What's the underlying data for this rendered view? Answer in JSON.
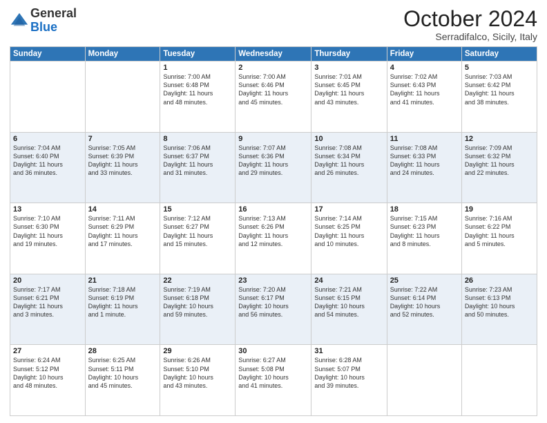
{
  "header": {
    "logo": {
      "line1": "General",
      "line2": "Blue"
    },
    "title": "October 2024",
    "subtitle": "Serradifalco, Sicily, Italy"
  },
  "days_of_week": [
    "Sunday",
    "Monday",
    "Tuesday",
    "Wednesday",
    "Thursday",
    "Friday",
    "Saturday"
  ],
  "weeks": [
    [
      {
        "day": "",
        "info": ""
      },
      {
        "day": "",
        "info": ""
      },
      {
        "day": "1",
        "info": "Sunrise: 7:00 AM\nSunset: 6:48 PM\nDaylight: 11 hours\nand 48 minutes."
      },
      {
        "day": "2",
        "info": "Sunrise: 7:00 AM\nSunset: 6:46 PM\nDaylight: 11 hours\nand 45 minutes."
      },
      {
        "day": "3",
        "info": "Sunrise: 7:01 AM\nSunset: 6:45 PM\nDaylight: 11 hours\nand 43 minutes."
      },
      {
        "day": "4",
        "info": "Sunrise: 7:02 AM\nSunset: 6:43 PM\nDaylight: 11 hours\nand 41 minutes."
      },
      {
        "day": "5",
        "info": "Sunrise: 7:03 AM\nSunset: 6:42 PM\nDaylight: 11 hours\nand 38 minutes."
      }
    ],
    [
      {
        "day": "6",
        "info": "Sunrise: 7:04 AM\nSunset: 6:40 PM\nDaylight: 11 hours\nand 36 minutes."
      },
      {
        "day": "7",
        "info": "Sunrise: 7:05 AM\nSunset: 6:39 PM\nDaylight: 11 hours\nand 33 minutes."
      },
      {
        "day": "8",
        "info": "Sunrise: 7:06 AM\nSunset: 6:37 PM\nDaylight: 11 hours\nand 31 minutes."
      },
      {
        "day": "9",
        "info": "Sunrise: 7:07 AM\nSunset: 6:36 PM\nDaylight: 11 hours\nand 29 minutes."
      },
      {
        "day": "10",
        "info": "Sunrise: 7:08 AM\nSunset: 6:34 PM\nDaylight: 11 hours\nand 26 minutes."
      },
      {
        "day": "11",
        "info": "Sunrise: 7:08 AM\nSunset: 6:33 PM\nDaylight: 11 hours\nand 24 minutes."
      },
      {
        "day": "12",
        "info": "Sunrise: 7:09 AM\nSunset: 6:32 PM\nDaylight: 11 hours\nand 22 minutes."
      }
    ],
    [
      {
        "day": "13",
        "info": "Sunrise: 7:10 AM\nSunset: 6:30 PM\nDaylight: 11 hours\nand 19 minutes."
      },
      {
        "day": "14",
        "info": "Sunrise: 7:11 AM\nSunset: 6:29 PM\nDaylight: 11 hours\nand 17 minutes."
      },
      {
        "day": "15",
        "info": "Sunrise: 7:12 AM\nSunset: 6:27 PM\nDaylight: 11 hours\nand 15 minutes."
      },
      {
        "day": "16",
        "info": "Sunrise: 7:13 AM\nSunset: 6:26 PM\nDaylight: 11 hours\nand 12 minutes."
      },
      {
        "day": "17",
        "info": "Sunrise: 7:14 AM\nSunset: 6:25 PM\nDaylight: 11 hours\nand 10 minutes."
      },
      {
        "day": "18",
        "info": "Sunrise: 7:15 AM\nSunset: 6:23 PM\nDaylight: 11 hours\nand 8 minutes."
      },
      {
        "day": "19",
        "info": "Sunrise: 7:16 AM\nSunset: 6:22 PM\nDaylight: 11 hours\nand 5 minutes."
      }
    ],
    [
      {
        "day": "20",
        "info": "Sunrise: 7:17 AM\nSunset: 6:21 PM\nDaylight: 11 hours\nand 3 minutes."
      },
      {
        "day": "21",
        "info": "Sunrise: 7:18 AM\nSunset: 6:19 PM\nDaylight: 11 hours\nand 1 minute."
      },
      {
        "day": "22",
        "info": "Sunrise: 7:19 AM\nSunset: 6:18 PM\nDaylight: 10 hours\nand 59 minutes."
      },
      {
        "day": "23",
        "info": "Sunrise: 7:20 AM\nSunset: 6:17 PM\nDaylight: 10 hours\nand 56 minutes."
      },
      {
        "day": "24",
        "info": "Sunrise: 7:21 AM\nSunset: 6:15 PM\nDaylight: 10 hours\nand 54 minutes."
      },
      {
        "day": "25",
        "info": "Sunrise: 7:22 AM\nSunset: 6:14 PM\nDaylight: 10 hours\nand 52 minutes."
      },
      {
        "day": "26",
        "info": "Sunrise: 7:23 AM\nSunset: 6:13 PM\nDaylight: 10 hours\nand 50 minutes."
      }
    ],
    [
      {
        "day": "27",
        "info": "Sunrise: 6:24 AM\nSunset: 5:12 PM\nDaylight: 10 hours\nand 48 minutes."
      },
      {
        "day": "28",
        "info": "Sunrise: 6:25 AM\nSunset: 5:11 PM\nDaylight: 10 hours\nand 45 minutes."
      },
      {
        "day": "29",
        "info": "Sunrise: 6:26 AM\nSunset: 5:10 PM\nDaylight: 10 hours\nand 43 minutes."
      },
      {
        "day": "30",
        "info": "Sunrise: 6:27 AM\nSunset: 5:08 PM\nDaylight: 10 hours\nand 41 minutes."
      },
      {
        "day": "31",
        "info": "Sunrise: 6:28 AM\nSunset: 5:07 PM\nDaylight: 10 hours\nand 39 minutes."
      },
      {
        "day": "",
        "info": ""
      },
      {
        "day": "",
        "info": ""
      }
    ]
  ]
}
